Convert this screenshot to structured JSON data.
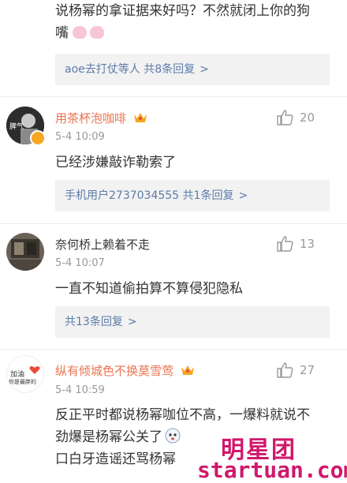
{
  "top_comment": {
    "line1": "说杨幂的拿证据来好吗？不然就闭上你的狗",
    "line2": "嘴",
    "reply_summary": {
      "users": "aoe去打仗",
      "suffix": "等人",
      "count_label": "共8条回复"
    }
  },
  "comments": [
    {
      "username": "用茶杯泡咖啡",
      "time": "5-4 10:09",
      "text": "已经涉嫌敲诈勒索了",
      "likes": "20",
      "avatar_text": "脾气",
      "reply_summary": {
        "users": "手机用户2737034555",
        "suffix": "",
        "count_label": "共1条回复"
      }
    },
    {
      "username": "奈何桥上赖着不走",
      "time": "5-4 10:07",
      "text": "一直不知道偷拍算不算侵犯隐私",
      "likes": "13",
      "reply_summary": {
        "users": "",
        "suffix": "",
        "count_label": "共13条回复"
      }
    },
    {
      "username": "纵有倾城色不换莫雪莺",
      "time": "5-4 10:59",
      "text_line1": "反正平时都说杨幂咖位不高，一爆料就说不",
      "text_line2": "劲爆是杨幂公关了",
      "text_line3": "口白牙造谣还骂杨幂",
      "likes": "27",
      "avatar_text1": "加油",
      "avatar_text2": "你是最胖的"
    }
  ],
  "watermark": {
    "main": "明星团",
    "sub": "startuan.com"
  },
  "colors": {
    "link": "#5b7ca8",
    "username_orange": "#eb7350",
    "watermark": "#d0186b"
  }
}
